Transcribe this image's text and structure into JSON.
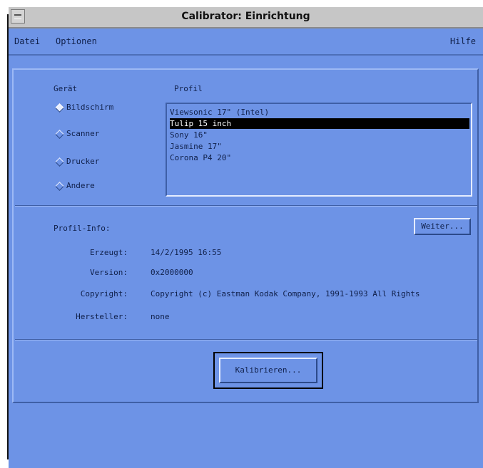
{
  "window": {
    "title": "Calibrator: Einrichtung"
  },
  "menubar": {
    "file": "Datei",
    "options": "Optionen",
    "help": "Hilfe"
  },
  "device": {
    "heading": "Gerät",
    "options": [
      "Bildschirm",
      "Scanner",
      "Drucker",
      "Andere"
    ],
    "selected_index": 0
  },
  "profile": {
    "heading": "Profil",
    "items": [
      "Viewsonic 17\" (Intel)",
      "Tulip 15 inch",
      "Sony 16\"",
      "Jasmine 17\"",
      "Corona P4 20\""
    ],
    "selected_index": 1
  },
  "info": {
    "heading": "Profil-Info:",
    "more_button": "Weiter...",
    "created_label": "Erzeugt:",
    "created_value": "14/2/1995 16:55",
    "version_label": "Version:",
    "version_value": "0x2000000",
    "copyright_label": "Copyright:",
    "copyright_value": "Copyright (c) Eastman Kodak Company, 1991-1993 All Rights",
    "manufacturer_label": "Hersteller:",
    "manufacturer_value": "none"
  },
  "actions": {
    "calibrate_button": "Kalibrieren..."
  }
}
